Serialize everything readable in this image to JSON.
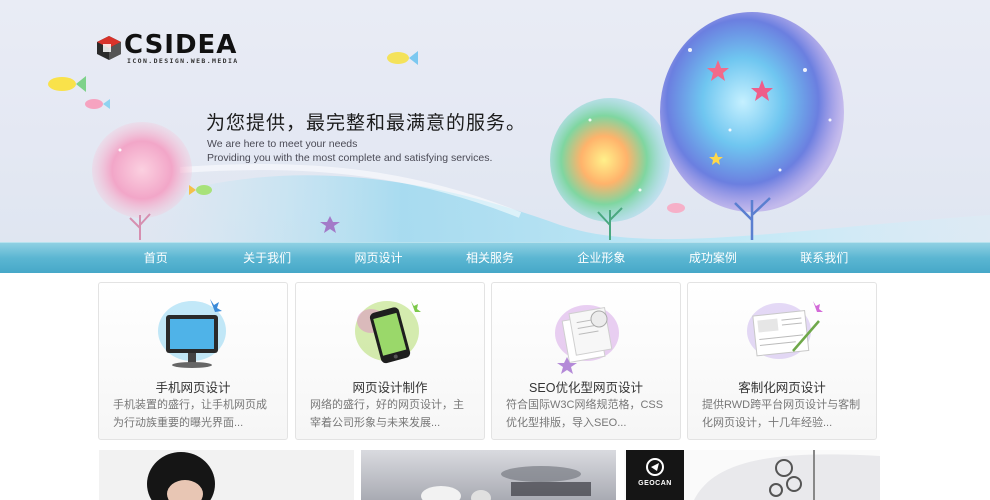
{
  "brand": {
    "logo_text": "CSIDEA",
    "logo_tagline": "ICON.DESIGN.WEB.MEDIA"
  },
  "hero": {
    "slogan": "为您提供，最完整和最满意的服务。",
    "sub_line_1": "We are here to meet your needs",
    "sub_line_2": "Providing you with the most complete and satisfying services."
  },
  "nav": {
    "items": [
      {
        "label": "首页"
      },
      {
        "label": "关于我们"
      },
      {
        "label": "网页设计"
      },
      {
        "label": "相关服务"
      },
      {
        "label": "企业形象"
      },
      {
        "label": "成功案例"
      },
      {
        "label": "联系我们"
      }
    ]
  },
  "services": [
    {
      "title": "手机网页设计",
      "desc": "手机装置的盛行，让手机网页成为行动族重要的曝光界面...",
      "icon": "monitor-icon"
    },
    {
      "title": "网页设计制作",
      "desc": "网络的盛行，好的网页设计，主宰着公司形象与未来发展...",
      "icon": "smartphone-icon"
    },
    {
      "title": "SEO优化型网页设计",
      "desc": "符合国际W3C网络规范格，CSS优化型排版，导入SEO...",
      "icon": "seo-pages-icon"
    },
    {
      "title": "客制化网页设计",
      "desc": "提供RWD跨平台网页设计与客制化网页设计，十几年经验...",
      "icon": "wireframe-icon"
    }
  ],
  "thumbnails": {
    "third_logo_text": "GEOCAN"
  },
  "colors": {
    "nav_top": "#8fd0e3",
    "nav_bottom": "#46a8c8",
    "hero_bg": "#e6eaf4"
  }
}
